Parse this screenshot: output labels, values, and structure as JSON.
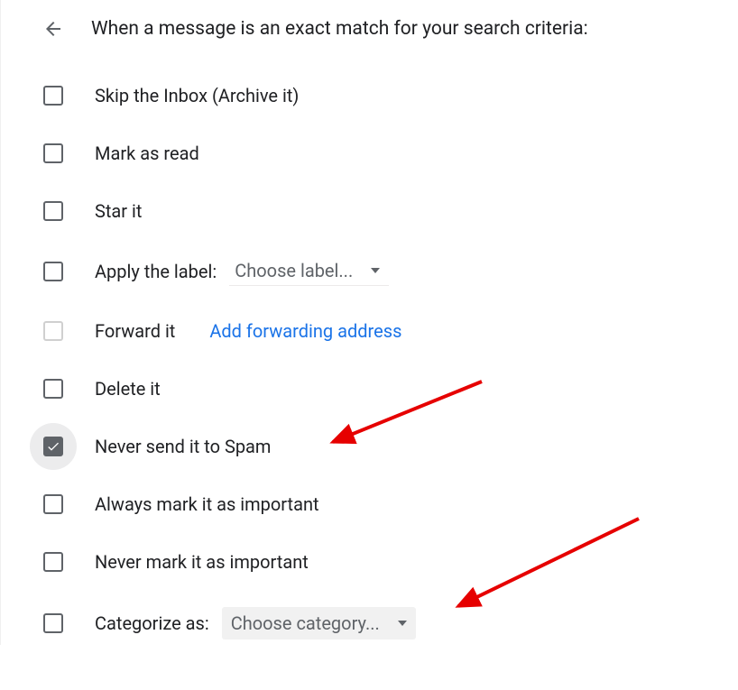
{
  "header": {
    "title": "When a message is an exact match for your search criteria:"
  },
  "options": {
    "skip_inbox": "Skip the Inbox (Archive it)",
    "mark_read": "Mark as read",
    "star_it": "Star it",
    "apply_label": "Apply the label:",
    "apply_label_dropdown": "Choose label...",
    "forward_it": "Forward it",
    "forward_link": "Add forwarding address",
    "delete_it": "Delete it",
    "never_spam": "Never send it to Spam",
    "always_important": "Always mark it as important",
    "never_important": "Never mark it as important",
    "categorize": "Categorize as:",
    "categorize_dropdown": "Choose category..."
  },
  "state": {
    "never_spam_checked": true
  },
  "annotations": {
    "arrow1": {
      "target": "never_spam"
    },
    "arrow2": {
      "target": "categorize_dropdown"
    }
  }
}
